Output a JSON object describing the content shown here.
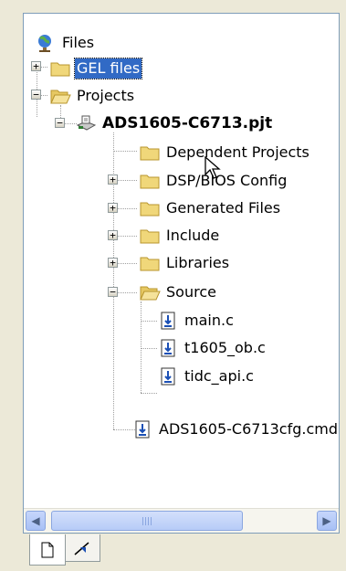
{
  "tree": {
    "root": {
      "label": "Files",
      "icon": "globe-icon"
    },
    "gel": {
      "label": "GEL files",
      "icon": "folder-closed-icon",
      "expander": "+"
    },
    "projects": {
      "label": "Projects",
      "icon": "folder-open-icon",
      "expander": "−"
    },
    "project": {
      "label": "ADS1605-C6713.pjt",
      "icon": "project-icon",
      "expander": "−"
    },
    "children": [
      {
        "label": "Dependent Projects",
        "icon": "folder-closed-icon",
        "expander": ""
      },
      {
        "label": "DSP/BIOS Config",
        "icon": "folder-closed-icon",
        "expander": "+"
      },
      {
        "label": "Generated Files",
        "icon": "folder-closed-icon",
        "expander": "+"
      },
      {
        "label": "Include",
        "icon": "folder-closed-icon",
        "expander": "+"
      },
      {
        "label": "Libraries",
        "icon": "folder-closed-icon",
        "expander": "+"
      },
      {
        "label": "Source",
        "icon": "folder-open-icon",
        "expander": "−"
      }
    ],
    "source_files": [
      {
        "label": "main.c",
        "icon": "source-file-icon"
      },
      {
        "label": "t1605_ob.c",
        "icon": "source-file-icon"
      },
      {
        "label": "tidc_api.c",
        "icon": "source-file-icon"
      }
    ],
    "cmd_file": {
      "label": "ADS1605-C6713cfg.cmd",
      "icon": "source-file-icon"
    }
  },
  "scrollbar": {
    "left": "◀",
    "right": "▶"
  },
  "tabs": [
    {
      "name": "file-view-tab",
      "icon": "page-icon"
    },
    {
      "name": "bookmark-tab",
      "icon": "bookmark-icon"
    }
  ],
  "colors": {
    "selection": "#316AC5",
    "window_bg": "#ECE9D8",
    "folder": "#F0D77A"
  }
}
